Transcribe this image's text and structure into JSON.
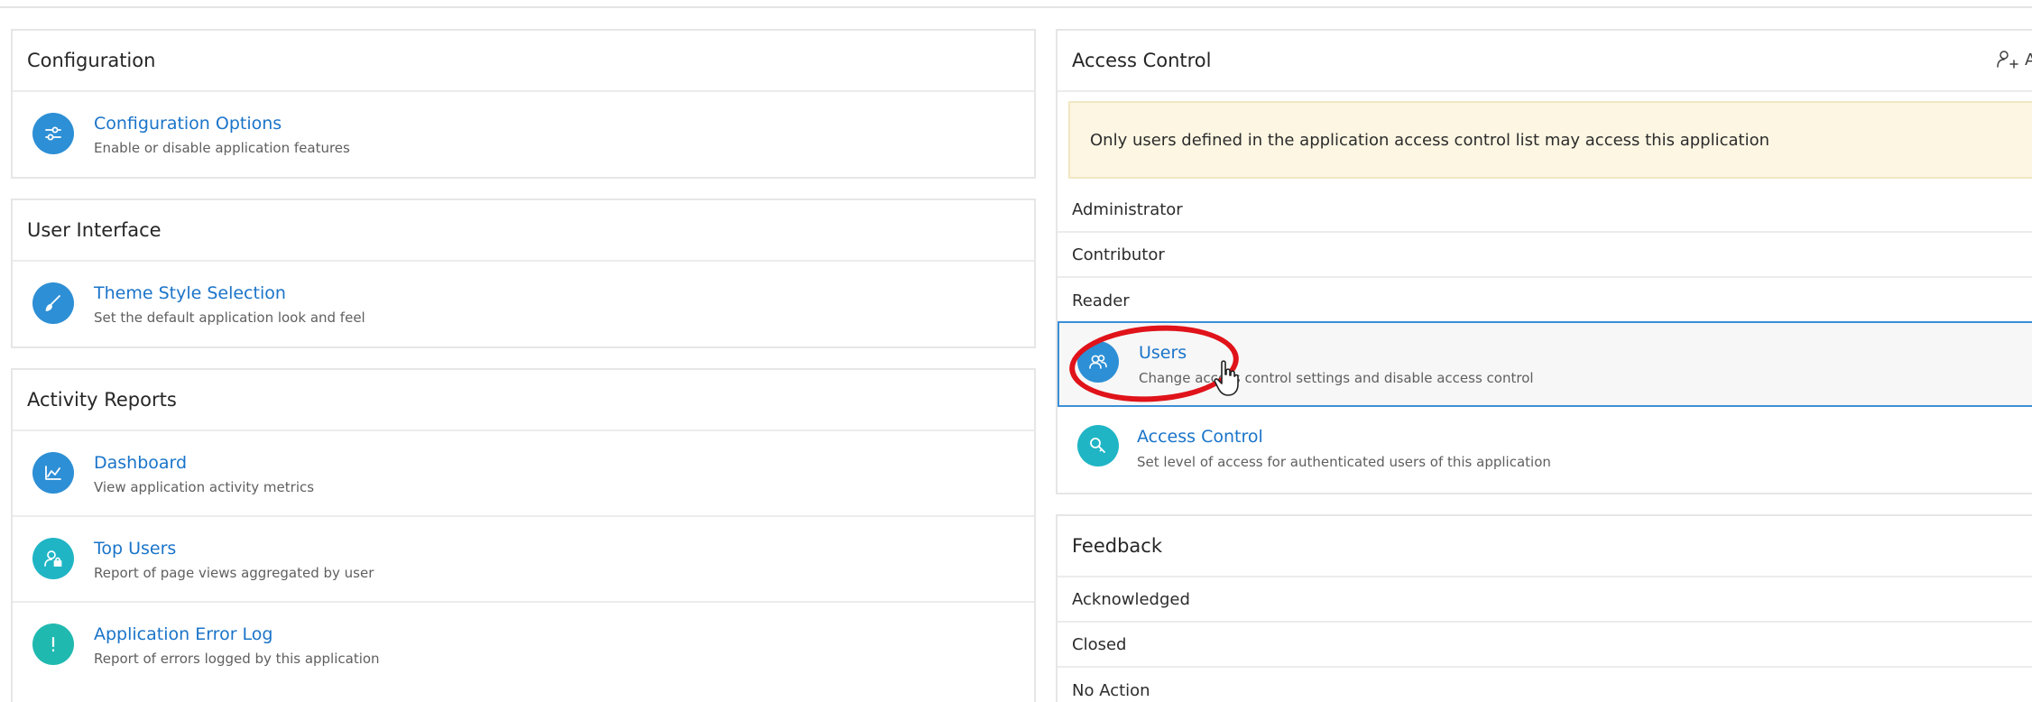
{
  "configuration": {
    "title": "Configuration",
    "items": [
      {
        "title": "Configuration Options",
        "description": "Enable or disable application features",
        "icon": "sliders-icon",
        "color": "#2d8fd5"
      }
    ]
  },
  "user_interface": {
    "title": "User Interface",
    "items": [
      {
        "title": "Theme Style Selection",
        "description": "Set the default application look and feel",
        "icon": "brush-icon",
        "color": "#2d8fd5"
      }
    ]
  },
  "activity_reports": {
    "title": "Activity Reports",
    "items": [
      {
        "title": "Dashboard",
        "description": "View application activity metrics",
        "icon": "chart-icon",
        "color": "#2d8fd5"
      },
      {
        "title": "Top Users",
        "description": "Report of page views aggregated by user",
        "icon": "user-lock-icon",
        "color": "#1fb5c5"
      },
      {
        "title": "Application Error Log",
        "description": "Report of errors logged by this application",
        "icon": "exclamation-icon",
        "color": "#20b9b0"
      }
    ]
  },
  "access_control": {
    "title": "Access Control",
    "add_label": "A",
    "alert": "Only users defined in the application access control list may access this application",
    "roles": [
      "Administrator",
      "Contributor",
      "Reader"
    ],
    "items": [
      {
        "title": "Users",
        "description": "Change access control settings and disable access control",
        "icon": "users-icon",
        "color": "#2d8fd5"
      },
      {
        "title": "Access Control",
        "description": "Set level of access for authenticated users of this application",
        "icon": "key-icon",
        "color": "#1fb5c5"
      }
    ]
  },
  "feedback": {
    "title": "Feedback",
    "statuses": [
      "Acknowledged",
      "Closed",
      "No Action"
    ]
  }
}
